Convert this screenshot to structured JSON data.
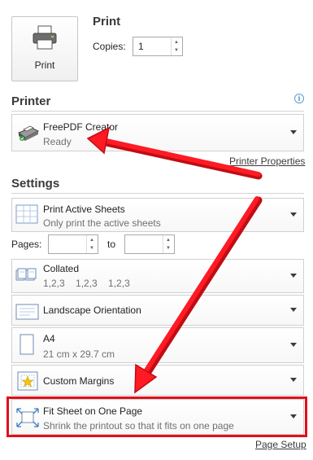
{
  "print": {
    "heading": "Print",
    "button_label": "Print",
    "copies_label": "Copies:",
    "copies_value": "1"
  },
  "printer": {
    "heading": "Printer",
    "name": "FreePDF Creator",
    "status": "Ready",
    "properties_link": "Printer Properties"
  },
  "settings": {
    "heading": "Settings",
    "what": {
      "title": "Print Active Sheets",
      "sub": "Only print the active sheets"
    },
    "pages_label": "Pages:",
    "pages_from": "",
    "pages_to_label": "to",
    "pages_to": "",
    "collated": {
      "title": "Collated",
      "sub": "1,2,3    1,2,3    1,2,3"
    },
    "orientation": {
      "title": "Landscape Orientation"
    },
    "paper": {
      "title": "A4",
      "sub": "21 cm x 29.7 cm"
    },
    "margins": {
      "title": "Custom Margins"
    },
    "scaling": {
      "title": "Fit Sheet on One Page",
      "sub": "Shrink the printout so that it fits on one page"
    },
    "page_setup_link": "Page Setup"
  },
  "annotations": {
    "arrow_color": "#e0101a",
    "highlight_color": "#e0101a"
  }
}
